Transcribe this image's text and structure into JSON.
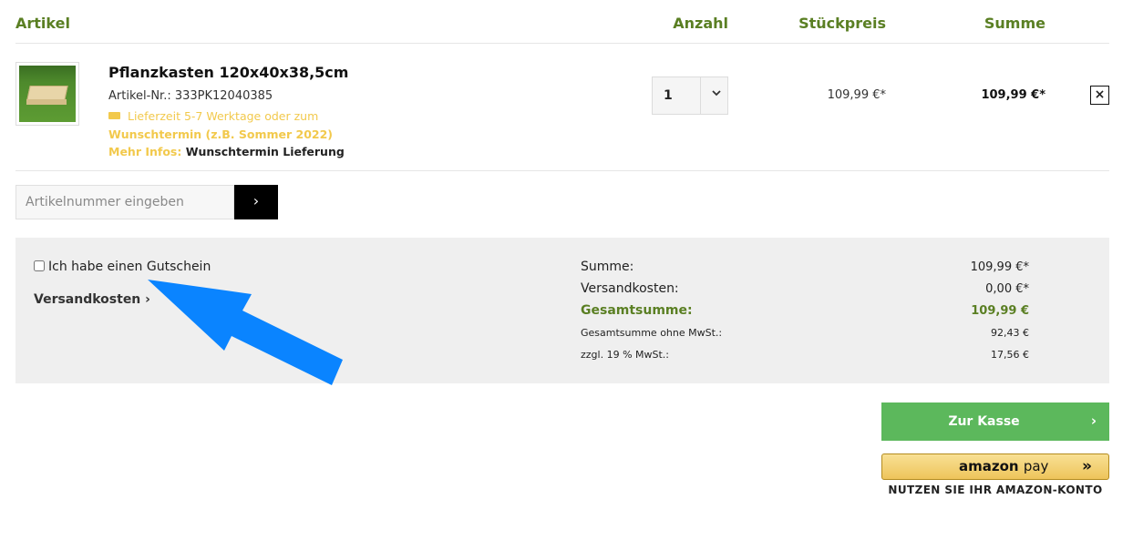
{
  "table_header": {
    "artikel": "Artikel",
    "anzahl": "Anzahl",
    "stueckpreis": "Stückpreis",
    "summe": "Summe"
  },
  "item": {
    "title": "Pflanzkasten 120x40x38,5cm",
    "sku": "Artikel-Nr.: 333PK12040385",
    "delivery": "Lieferzeit 5-7 Werktage oder zum",
    "wunschtermin": "Wunschtermin (z.B. Sommer 2022)",
    "mehr_label": "Mehr Infos:",
    "mehr_link": "Wunschtermin Lieferung",
    "quantity": "1",
    "unit_price": "109,99 €*",
    "line_total": "109,99 €*",
    "remove_label": "×"
  },
  "sku_entry": {
    "placeholder": "Artikelnummer eingeben",
    "button": "›"
  },
  "summary": {
    "voucher_label": "Ich habe einen Gutschein",
    "shipping_link": "Versandkosten ›",
    "rows": [
      {
        "label": "Summe:",
        "value": "109,99 €*"
      },
      {
        "label": "Versandkosten:",
        "value": "0,00 €*"
      },
      {
        "label": "Gesamtsumme:",
        "value": "109,99 €"
      },
      {
        "label": "Gesamtsumme ohne MwSt.:",
        "value": "92,43 €"
      },
      {
        "label": "zzgl. 19 % MwSt.:",
        "value": "17,56 €"
      }
    ]
  },
  "checkout": {
    "label": "Zur Kasse",
    "chevron": "›"
  },
  "amazon": {
    "logo_word": "amazon",
    "pay_word": "pay",
    "arrows": "»",
    "note": "NUTZEN SIE IHR AMAZON-KONTO"
  },
  "colors": {
    "accent_green": "#5a7f23",
    "checkout_green": "#5cb85c",
    "delivery_yellow": "#f2c94c",
    "arrow_blue": "#0a84ff"
  }
}
